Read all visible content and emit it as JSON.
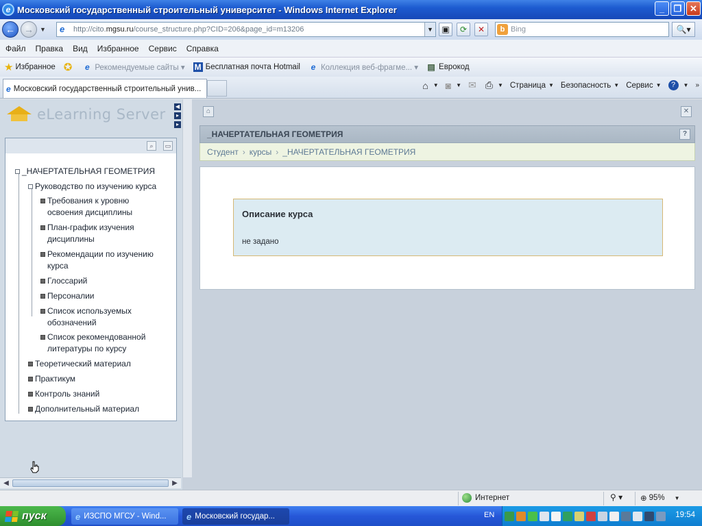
{
  "window": {
    "title": "Московский государственный строительный университет - Windows Internet Explorer"
  },
  "address": {
    "url_prefix": "http://cito.",
    "url_domain": "mgsu.ru",
    "url_path": "/course_structure.php?CID=206&page_id=m13206",
    "search_placeholder": "Bing"
  },
  "menu": [
    "Файл",
    "Правка",
    "Вид",
    "Избранное",
    "Сервис",
    "Справка"
  ],
  "favorites": {
    "label": "Избранное",
    "items": [
      {
        "label": "Рекомендуемые сайты ▾",
        "dim": true
      },
      {
        "label": "Бесплатная почта Hotmail",
        "dim": false
      },
      {
        "label": "Коллекция веб-фрагме... ▾",
        "dim": true
      },
      {
        "label": "Еврокод",
        "dim": false
      }
    ]
  },
  "tab": {
    "label": "Московский государственный строительный унив..."
  },
  "commands": {
    "page": "Страница",
    "safety": "Безопасность",
    "tools": "Сервис"
  },
  "logo": {
    "text": "eLearning Server"
  },
  "tree": {
    "root": "_НАЧЕРТАТЕЛЬНАЯ ГЕОМЕТРИЯ",
    "guide": "Руководство по изучению курса",
    "guide_children": [
      [
        "Требования к уровню",
        "освоения дисциплины"
      ],
      [
        "План-график изучения",
        "дисциплины"
      ],
      [
        "Рекомендации по изучению",
        "курса"
      ],
      [
        "Глоссарий"
      ],
      [
        "Персоналии"
      ],
      [
        "Список используемых",
        "обозначений"
      ],
      [
        "Список рекомендованной",
        "литературы по курсу"
      ]
    ],
    "sections": [
      "Теоретический материал",
      "Практикум",
      "Контроль знаний",
      "Дополнительный материал"
    ]
  },
  "main": {
    "course_title": "_НАЧЕРТАТЕЛЬНАЯ ГЕОМЕТРИЯ",
    "breadcrumbs": [
      "Студент",
      "курсы",
      "_НАЧЕРТАТЕЛЬНАЯ ГЕОМЕТРИЯ"
    ],
    "breadcrumb_separator": "›",
    "description_title": "Описание курса",
    "description_text": "не задано"
  },
  "status": {
    "zone": "Интернет",
    "zoom": "95%"
  },
  "taskbar": {
    "start": "пуск",
    "items": [
      "ИЗСПО МГСУ - Wind...",
      "Московский государ..."
    ],
    "lang": "EN",
    "clock": "19:54"
  }
}
